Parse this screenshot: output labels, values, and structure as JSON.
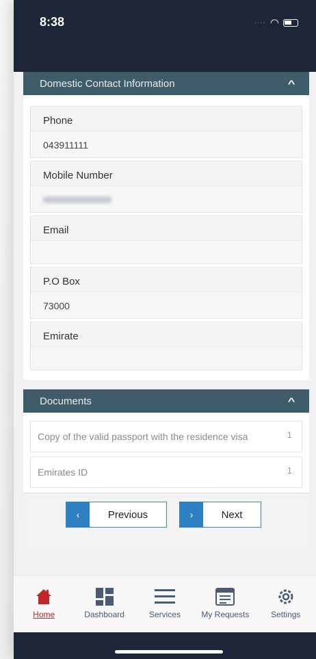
{
  "status": {
    "time": "8:38"
  },
  "contact": {
    "title": "Domestic Contact Information",
    "fields": [
      {
        "label": "Phone",
        "value": "043911111"
      },
      {
        "label": "Mobile Number",
        "value": ""
      },
      {
        "label": "Email",
        "value": ""
      },
      {
        "label": "P.O Box",
        "value": "73000"
      },
      {
        "label": "Emirate",
        "value": ""
      }
    ]
  },
  "documents": {
    "title": "Documents",
    "items": [
      {
        "name": "Copy of the valid passport with the residence visa",
        "count": "1"
      },
      {
        "name": "Emirates ID",
        "count": "1"
      }
    ]
  },
  "buttons": {
    "previous": "Previous",
    "next": "Next"
  },
  "tabs": [
    {
      "label": "Home",
      "icon": "home-icon"
    },
    {
      "label": "Dashboard",
      "icon": "dashboard-icon"
    },
    {
      "label": "Services",
      "icon": "menu-icon"
    },
    {
      "label": "My Requests",
      "icon": "requests-icon"
    },
    {
      "label": "Settings",
      "icon": "gear-icon"
    }
  ],
  "colors": {
    "header": "#1c2638",
    "section": "#3e5c6a",
    "accent": "#2f7fc3",
    "active": "#c0262d"
  }
}
